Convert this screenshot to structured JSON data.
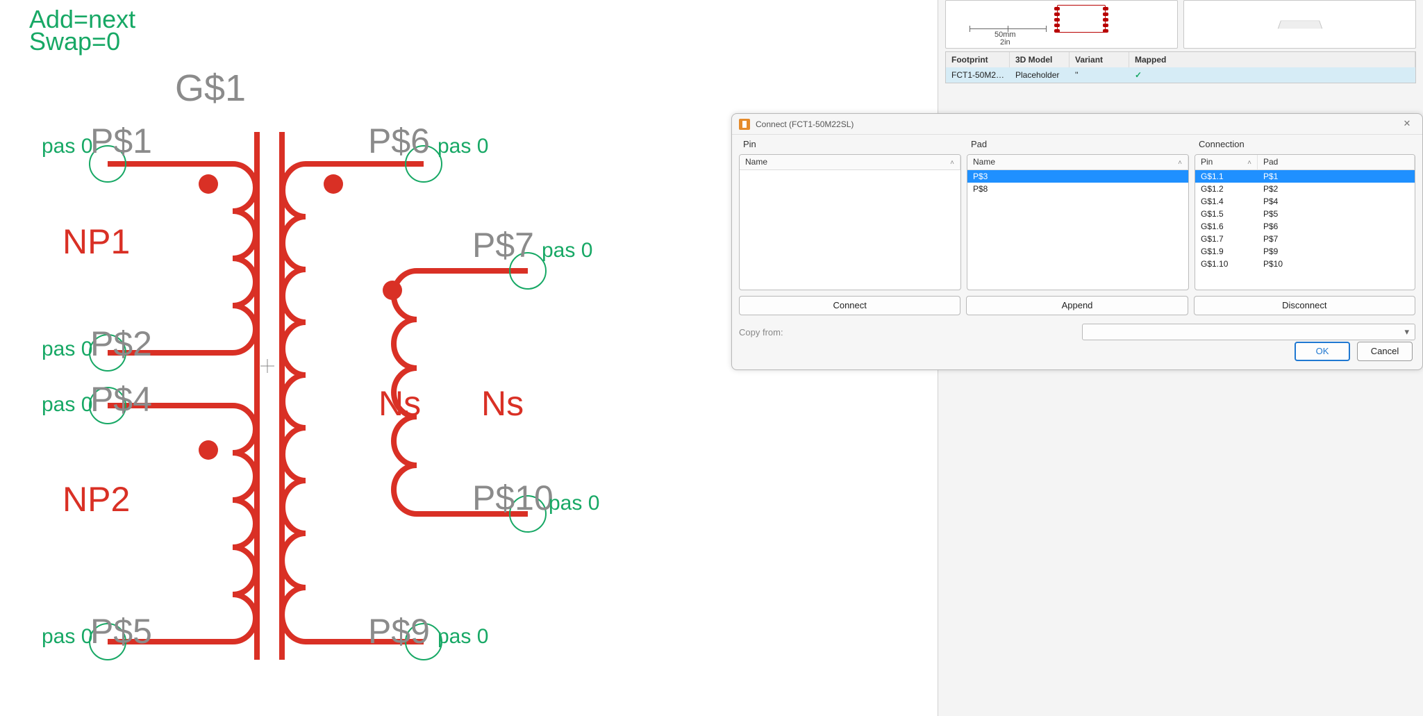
{
  "schematic": {
    "hud": {
      "line1": "Add=next",
      "line2": "Swap=0"
    },
    "part_label": "G$1",
    "windings": {
      "np1": "NP1",
      "np2": "NP2",
      "nsA": "Ns",
      "nsB": "Ns"
    },
    "left_pins": [
      {
        "pas": "pas 0",
        "name": "P$1"
      },
      {
        "pas": "pas 0",
        "name": "P$2"
      },
      {
        "pas": "pas 0",
        "name": "P$4"
      },
      {
        "pas": "pas 0",
        "name": "P$5"
      }
    ],
    "right_pins": [
      {
        "name": "P$6",
        "pas": "pas 0"
      },
      {
        "name": "P$7",
        "pas": "pas 0"
      },
      {
        "name": "P$10",
        "pas": "pas 0"
      },
      {
        "name": "P$9",
        "pas": "pas 0"
      }
    ]
  },
  "library": {
    "ruler": {
      "top": "50mm",
      "bottom": "2in"
    },
    "columns": {
      "footprint": "Footprint",
      "model3d": "3D Model",
      "variant": "Variant",
      "mapped": "Mapped"
    },
    "row": {
      "footprint": "FCT1-50M2…",
      "model3d": "Placeholder",
      "variant": "''",
      "mapped": "✓"
    }
  },
  "dialog": {
    "title": "Connect  (FCT1-50M22SL)",
    "groups": {
      "pin": "Pin",
      "pad": "Pad",
      "connection": "Connection"
    },
    "pin_list": {
      "header": "Name",
      "rows": []
    },
    "pad_list": {
      "header": "Name",
      "rows": [
        {
          "name": "P$3",
          "selected": true
        },
        {
          "name": "P$8",
          "selected": false
        }
      ]
    },
    "conn_list": {
      "headers": {
        "pin": "Pin",
        "pad": "Pad"
      },
      "rows": [
        {
          "pin": "G$1.1",
          "pad": "P$1",
          "selected": true
        },
        {
          "pin": "G$1.2",
          "pad": "P$2",
          "selected": false
        },
        {
          "pin": "G$1.4",
          "pad": "P$4",
          "selected": false
        },
        {
          "pin": "G$1.5",
          "pad": "P$5",
          "selected": false
        },
        {
          "pin": "G$1.6",
          "pad": "P$6",
          "selected": false
        },
        {
          "pin": "G$1.7",
          "pad": "P$7",
          "selected": false
        },
        {
          "pin": "G$1.9",
          "pad": "P$9",
          "selected": false
        },
        {
          "pin": "G$1.10",
          "pad": "P$10",
          "selected": false
        }
      ]
    },
    "buttons": {
      "connect": "Connect",
      "append": "Append",
      "disconnect": "Disconnect"
    },
    "copy_from_label": "Copy from:",
    "ok": "OK",
    "cancel": "Cancel"
  }
}
